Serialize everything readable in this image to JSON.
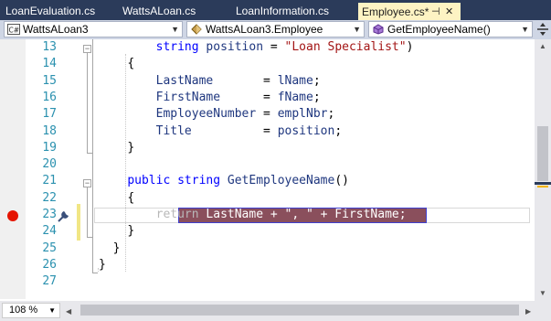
{
  "tabs": [
    {
      "label": "LoanEvaluation.cs",
      "active": false
    },
    {
      "label": "WattsALoan.cs",
      "active": false
    },
    {
      "label": "LoanInformation.cs",
      "active": false
    },
    {
      "label": "Employee.cs*",
      "active": true
    }
  ],
  "active_tab_glyphs": {
    "pin": "⊣",
    "close": "✕"
  },
  "nav": {
    "project": "WattsALoan3",
    "class": "WattsALoan3.Employee",
    "member": "GetEmployeeName()",
    "split_icon": "split-handle"
  },
  "lines": [
    {
      "num": "13",
      "indent": "        ",
      "tokens": [
        {
          "t": "string",
          "c": "kw"
        },
        {
          "t": " "
        },
        {
          "t": "position",
          "c": "id"
        },
        {
          "t": " = "
        },
        {
          "t": "\"Loan Specialist\"",
          "c": "str"
        },
        {
          "t": ")"
        }
      ]
    },
    {
      "num": "14",
      "indent": "    ",
      "tokens": [
        {
          "t": "{"
        }
      ]
    },
    {
      "num": "15",
      "indent": "        ",
      "tokens": [
        {
          "t": "LastName",
          "c": "id"
        },
        {
          "t": "       = "
        },
        {
          "t": "lName",
          "c": "id"
        },
        {
          "t": ";"
        }
      ]
    },
    {
      "num": "16",
      "indent": "        ",
      "tokens": [
        {
          "t": "FirstName",
          "c": "id"
        },
        {
          "t": "      = "
        },
        {
          "t": "fName",
          "c": "id"
        },
        {
          "t": ";"
        }
      ]
    },
    {
      "num": "17",
      "indent": "        ",
      "tokens": [
        {
          "t": "EmployeeNumber",
          "c": "id"
        },
        {
          "t": " = "
        },
        {
          "t": "emplNbr",
          "c": "id"
        },
        {
          "t": ";"
        }
      ]
    },
    {
      "num": "18",
      "indent": "        ",
      "tokens": [
        {
          "t": "Title",
          "c": "id"
        },
        {
          "t": "          = "
        },
        {
          "t": "position",
          "c": "id"
        },
        {
          "t": ";"
        }
      ]
    },
    {
      "num": "19",
      "indent": "    ",
      "tokens": [
        {
          "t": "}"
        }
      ]
    },
    {
      "num": "20",
      "indent": "",
      "tokens": []
    },
    {
      "num": "21",
      "indent": "    ",
      "tokens": [
        {
          "t": "public",
          "c": "kw"
        },
        {
          "t": " "
        },
        {
          "t": "string",
          "c": "kw"
        },
        {
          "t": " "
        },
        {
          "t": "GetEmployeeName",
          "c": "id"
        },
        {
          "t": "()"
        }
      ]
    },
    {
      "num": "22",
      "indent": "    ",
      "tokens": [
        {
          "t": "{"
        }
      ]
    },
    {
      "num": "23",
      "indent": "        ",
      "tokens": [
        {
          "t": "return",
          "c": "kw"
        },
        {
          "t": " LastName + \", \" + FirstName;"
        }
      ]
    },
    {
      "num": "24",
      "indent": "    ",
      "tokens": [
        {
          "t": "}"
        }
      ]
    },
    {
      "num": "25",
      "indent": "  ",
      "tokens": [
        {
          "t": "}"
        }
      ]
    },
    {
      "num": "26",
      "indent": "",
      "tokens": [
        {
          "t": "}"
        }
      ]
    },
    {
      "num": "27",
      "indent": "",
      "tokens": []
    }
  ],
  "breakpoint_line": "23",
  "zoom": {
    "value": "108 %"
  },
  "colors": {
    "breakpoint": "#e51400",
    "highlight_bg": "#8a4f5c",
    "highlight_border": "#3f3fcf"
  }
}
